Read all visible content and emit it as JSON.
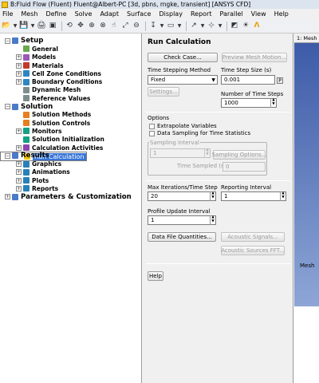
{
  "window": {
    "title": "B:Fluid Flow (Fluent) Fluent@Albert-PC  [3d, pbns, rngke, transient] [ANSYS CFD]"
  },
  "menu": [
    "File",
    "Mesh",
    "Define",
    "Solve",
    "Adapt",
    "Surface",
    "Display",
    "Report",
    "Parallel",
    "View",
    "Help"
  ],
  "tree": [
    {
      "label": "Setup",
      "level": 0,
      "expand": "−",
      "style": "top",
      "icon": "#4a7ac8"
    },
    {
      "label": "General",
      "level": 2,
      "style": "sub",
      "icon": "#6aa84f"
    },
    {
      "label": "Models",
      "level": 1,
      "expand": "+",
      "style": "sub",
      "icon": "#9b59b6"
    },
    {
      "label": "Materials",
      "level": 1,
      "expand": "+",
      "style": "sub",
      "icon": "#c0392b"
    },
    {
      "label": "Cell Zone Conditions",
      "level": 1,
      "expand": "+",
      "style": "sub",
      "icon": "#2e86c1"
    },
    {
      "label": "Boundary Conditions",
      "level": 1,
      "expand": "+",
      "style": "sub",
      "icon": "#2e86c1"
    },
    {
      "label": "Dynamic Mesh",
      "level": 2,
      "style": "sub",
      "icon": "#7f8c8d"
    },
    {
      "label": "Reference Values",
      "level": 2,
      "style": "sub",
      "icon": "#7f8c8d"
    },
    {
      "label": "Solution",
      "level": 0,
      "expand": "−",
      "style": "top",
      "icon": "#4a7ac8"
    },
    {
      "label": "Solution Methods",
      "level": 2,
      "style": "sub",
      "icon": "#e67e22"
    },
    {
      "label": "Solution Controls",
      "level": 2,
      "style": "sub",
      "icon": "#e67e22"
    },
    {
      "label": "Monitors",
      "level": 1,
      "expand": "+",
      "style": "sub",
      "icon": "#16a085"
    },
    {
      "label": "Solution Initialization",
      "level": 2,
      "style": "sub",
      "icon": "#16a085"
    },
    {
      "label": "Calculation Activities",
      "level": 1,
      "expand": "+",
      "style": "sub",
      "icon": "#8e44ad"
    },
    {
      "label": "Run Calculation",
      "level": 2,
      "style": "sel",
      "icon": "#f1c40f"
    },
    {
      "label": "Results",
      "level": 0,
      "expand": "−",
      "style": "top",
      "icon": "#4a7ac8"
    },
    {
      "label": "Graphics",
      "level": 1,
      "expand": "+",
      "style": "sub",
      "icon": "#2980b9"
    },
    {
      "label": "Animations",
      "level": 1,
      "expand": "+",
      "style": "sub",
      "icon": "#2980b9"
    },
    {
      "label": "Plots",
      "level": 1,
      "expand": "+",
      "style": "sub",
      "icon": "#2980b9"
    },
    {
      "label": "Reports",
      "level": 1,
      "expand": "+",
      "style": "sub",
      "icon": "#2980b9"
    },
    {
      "label": "Parameters & Customization",
      "level": 0,
      "expand": "+",
      "style": "top",
      "icon": "#4a7ac8"
    }
  ],
  "panel": {
    "title": "Run Calculation",
    "check_case": "Check Case...",
    "preview_mesh": "Preview Mesh Motion...",
    "time_stepping_method_label": "Time Stepping Method",
    "time_stepping_method_value": "Fixed",
    "time_step_size_label": "Time Step Size (s)",
    "time_step_size_value": "0.001",
    "p_button": "P",
    "settings_button": "Settings...",
    "num_time_steps_label": "Number of Time Steps",
    "num_time_steps_value": "1000",
    "options_label": "Options",
    "extrapolate_label": "Extrapolate Variables",
    "data_sampling_label": "Data Sampling for Time Statistics",
    "sampling_interval_label": "Sampling Interval",
    "sampling_interval_value": "1",
    "sampling_options_button": "Sampling Options...",
    "time_sampled_label": "Time Sampled (s)",
    "time_sampled_value": "0",
    "max_iter_label": "Max Iterations/Time Step",
    "max_iter_value": "20",
    "reporting_interval_label": "Reporting Interval",
    "reporting_interval_value": "1",
    "profile_update_label": "Profile Update Interval",
    "profile_update_value": "1",
    "data_file_quantities_button": "Data File Quantities...",
    "acoustic_signals_button": "Acoustic Signals...",
    "acoustic_sources_button": "Acoustic Sources FFT...",
    "help_button": "Help"
  },
  "viewer": {
    "tab_label": "1: Mesh",
    "mesh_label": "Mesh"
  }
}
